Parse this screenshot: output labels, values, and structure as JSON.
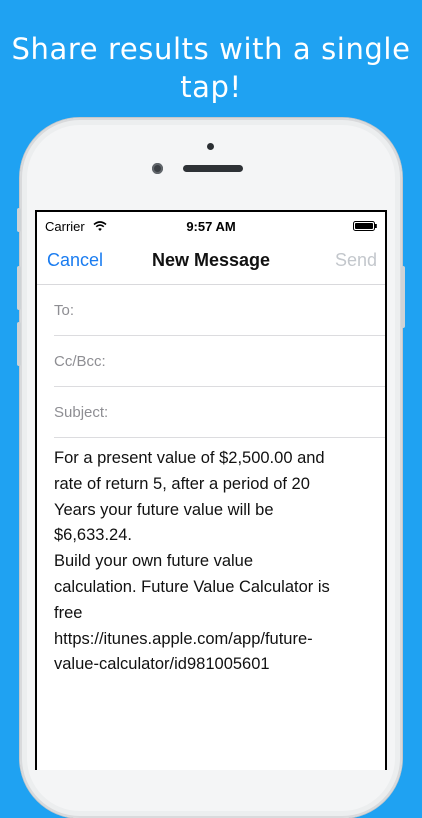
{
  "promo": {
    "line1": "Share results with a single",
    "line2": "tap!"
  },
  "status_bar": {
    "carrier": "Carrier",
    "time": "9:57 AM"
  },
  "nav": {
    "cancel": "Cancel",
    "title": "New Message",
    "send": "Send"
  },
  "fields": {
    "to": "To:",
    "cc_bcc": "Cc/Bcc:",
    "subject": "Subject:"
  },
  "message_lines": [
    "For a present value of $2,500.00 and",
    "rate of return 5, after a period of 20",
    "Years your future value will be",
    "$6,633.24.",
    "Build your own future value",
    "calculation. Future Value Calculator is",
    "free",
    "https://itunes.apple.com/app/future-",
    "value-calculator/id981005601"
  ],
  "colors": {
    "background": "#1FA2F2",
    "accent": "#1A7CF0",
    "disabled": "#C3C7CC"
  },
  "icons": [
    "wifi-icon",
    "battery-icon"
  ]
}
